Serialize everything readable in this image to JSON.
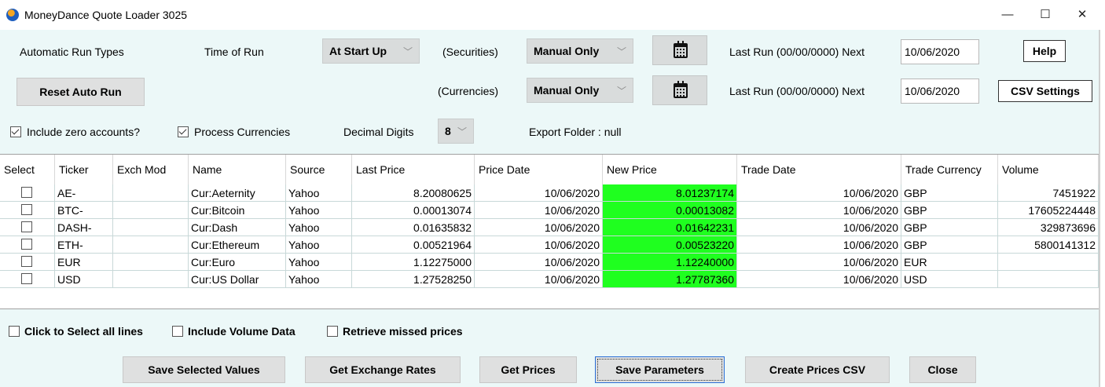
{
  "window": {
    "title": "MoneyDance Quote Loader 3025",
    "minimize_glyph": "—",
    "maximize_glyph": "☐",
    "close_glyph": "✕"
  },
  "settings": {
    "auto_run_types_label": "Automatic Run Types",
    "time_of_run_label": "Time of Run",
    "time_of_run_value": "At Start Up",
    "securities_label": "(Securities)",
    "securities_mode": "Manual Only",
    "currencies_label": "(Currencies)",
    "currencies_mode": "Manual Only",
    "last_run_securities": "Last Run (00/00/0000) Next",
    "next_date_securities": "10/06/2020",
    "last_run_currencies": "Last Run (00/00/0000) Next",
    "next_date_currencies": "10/06/2020",
    "help_label": "Help",
    "csv_settings_label": "CSV Settings",
    "reset_auto_run_label": "Reset Auto Run",
    "include_zero_label": "Include zero accounts?",
    "include_zero_checked": true,
    "process_currencies_label": "Process Currencies",
    "process_currencies_checked": true,
    "decimal_digits_label": "Decimal Digits",
    "decimal_digits_value": "8",
    "export_folder": "Export Folder : null",
    "dropdown_arrow": "﹀"
  },
  "table": {
    "columns": [
      "Select",
      "Ticker",
      "Exch Mod",
      "Name",
      "Source",
      "Last Price",
      "Price Date",
      "New Price",
      "Trade Date",
      "Trade Currency",
      "Volume"
    ],
    "rows": [
      {
        "ticker": "AE-",
        "exch": "",
        "name": "Cur:Aeternity",
        "source": "Yahoo",
        "last_price": "8.20080625",
        "price_date": "10/06/2020",
        "new_price": "8.01237174",
        "trade_date": "10/06/2020",
        "currency": "GBP",
        "volume": "7451922"
      },
      {
        "ticker": "BTC-",
        "exch": "",
        "name": "Cur:Bitcoin",
        "source": "Yahoo",
        "last_price": "0.00013074",
        "price_date": "10/06/2020",
        "new_price": "0.00013082",
        "trade_date": "10/06/2020",
        "currency": "GBP",
        "volume": "17605224448"
      },
      {
        "ticker": "DASH-",
        "exch": "",
        "name": "Cur:Dash",
        "source": "Yahoo",
        "last_price": "0.01635832",
        "price_date": "10/06/2020",
        "new_price": "0.01642231",
        "trade_date": "10/06/2020",
        "currency": "GBP",
        "volume": "329873696"
      },
      {
        "ticker": "ETH-",
        "exch": "",
        "name": "Cur:Ethereum",
        "source": "Yahoo",
        "last_price": "0.00521964",
        "price_date": "10/06/2020",
        "new_price": "0.00523220",
        "trade_date": "10/06/2020",
        "currency": "GBP",
        "volume": "5800141312"
      },
      {
        "ticker": "EUR",
        "exch": "",
        "name": "Cur:Euro",
        "source": "Yahoo",
        "last_price": "1.12275000",
        "price_date": "10/06/2020",
        "new_price": "1.12240000",
        "trade_date": "10/06/2020",
        "currency": "EUR",
        "volume": ""
      },
      {
        "ticker": "USD",
        "exch": "",
        "name": "Cur:US Dollar",
        "source": "Yahoo",
        "last_price": "1.27528250",
        "price_date": "10/06/2020",
        "new_price": "1.27787360",
        "trade_date": "10/06/2020",
        "currency": "USD",
        "volume": ""
      }
    ],
    "new_price_color": "#1fff1f"
  },
  "options": {
    "select_all_label": "Click to Select all lines",
    "include_volume_label": "Include Volume Data",
    "retrieve_missed_label": "Retrieve missed prices"
  },
  "actions": {
    "save_selected": "Save Selected Values",
    "get_exchange_rates": "Get Exchange Rates",
    "get_prices": "Get Prices",
    "save_parameters": "Save Parameters",
    "create_prices_csv": "Create Prices CSV",
    "close": "Close"
  }
}
